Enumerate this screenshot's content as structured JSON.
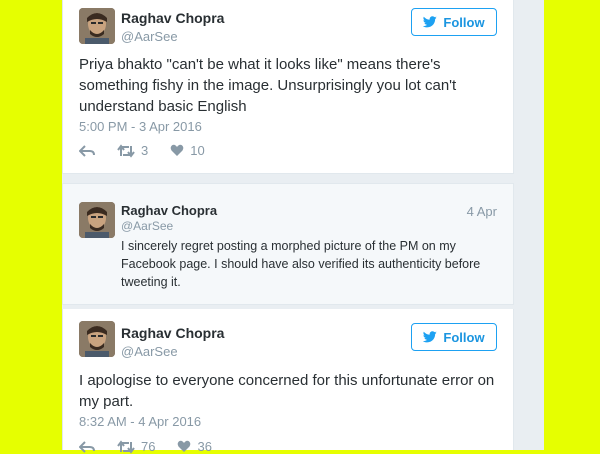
{
  "tweet1": {
    "name": "Raghav Chopra",
    "handle": "@AarSee",
    "follow_label": "Follow",
    "text": "Priya bhakto \"can't be what it looks like\" means there's something fishy in the image. Unsurprisingly you lot can't understand basic English",
    "timestamp": "5:00 PM - 3 Apr 2016",
    "retweets": "3",
    "likes": "10"
  },
  "tweet2": {
    "name": "Raghav Chopra",
    "handle": "@AarSee",
    "date": "4 Apr",
    "text": "I sincerely regret posting a morphed picture of the PM on my Facebook page. I should have also verified its authenticity before tweeting it."
  },
  "tweet3": {
    "name": "Raghav Chopra",
    "handle": "@AarSee",
    "follow_label": "Follow",
    "text": "I apologise to everyone concerned for this unfortunate error on my part.",
    "timestamp": "8:32 AM - 4 Apr 2016",
    "retweets": "76",
    "likes": "36"
  },
  "colors": {
    "background": "#e6ff00",
    "accent": "#1da1f2",
    "muted": "#8899a6",
    "text": "#292f33"
  },
  "icons": [
    "avatar",
    "twitter-bird-icon",
    "reply-icon",
    "retweet-icon",
    "heart-icon"
  ]
}
